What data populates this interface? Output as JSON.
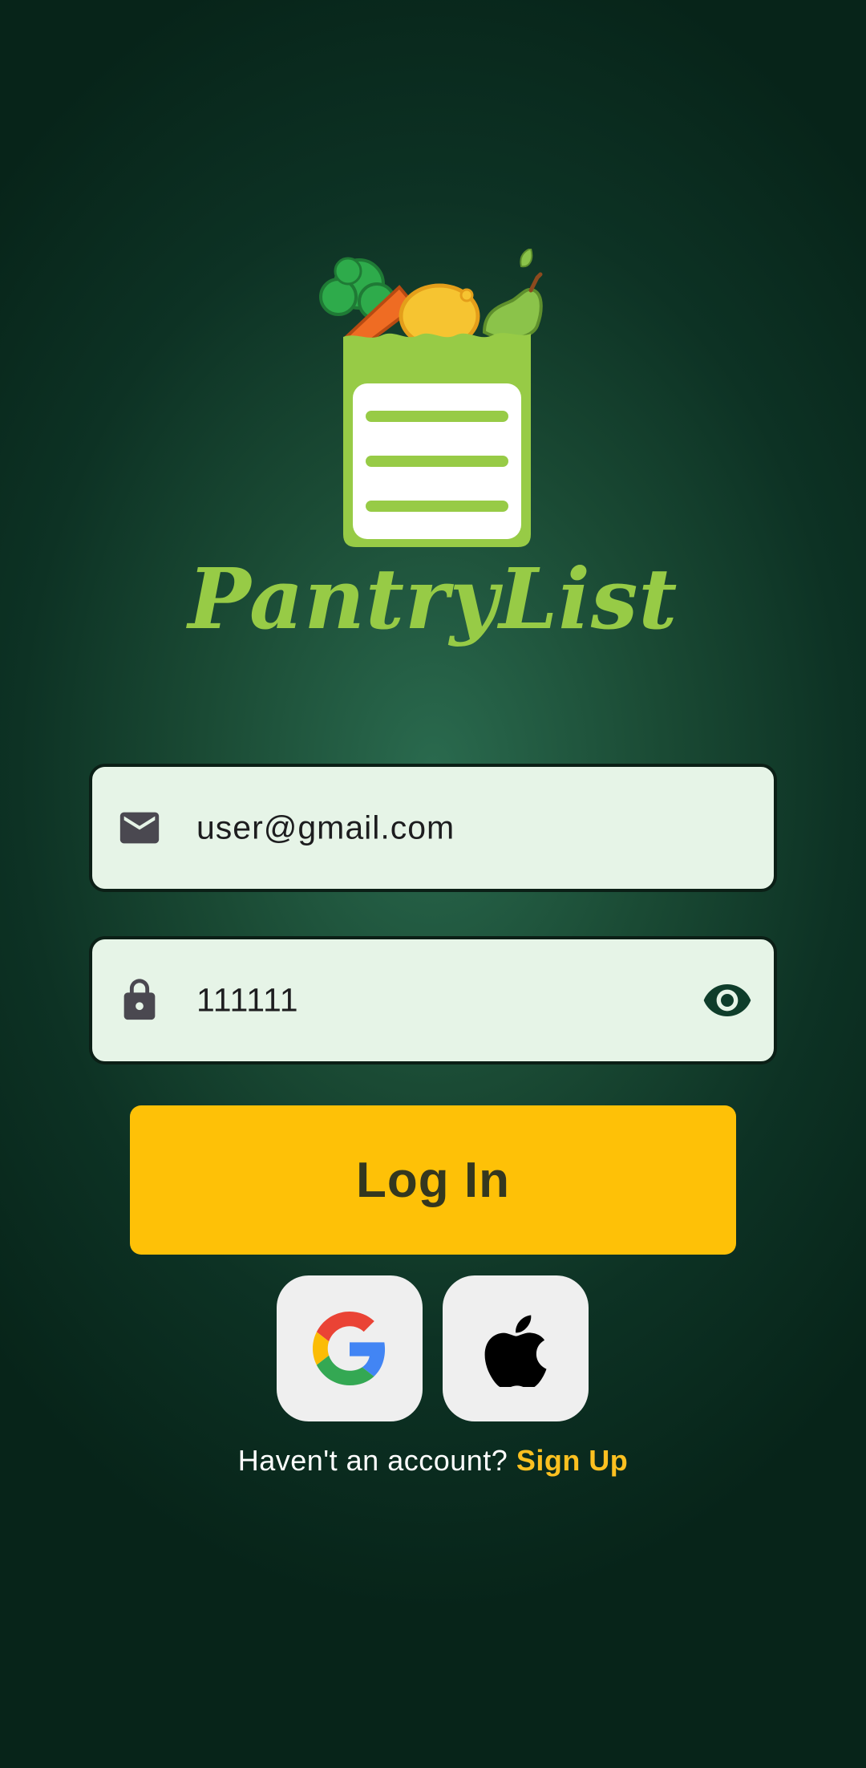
{
  "app": {
    "name": "PantryList"
  },
  "login_form": {
    "email_value": "user@gmail.com",
    "password_value": "111111",
    "login_label": "Log In"
  },
  "social_login": {
    "google_icon": "google-icon",
    "apple_icon": "apple-icon"
  },
  "signup": {
    "prompt": "Haven't an account?",
    "link_label": "Sign Up"
  },
  "colors": {
    "accent": "#fec107",
    "brand_green": "#97cb46",
    "field_bg": "#e6f4e7",
    "signup_link": "#fcc020"
  }
}
